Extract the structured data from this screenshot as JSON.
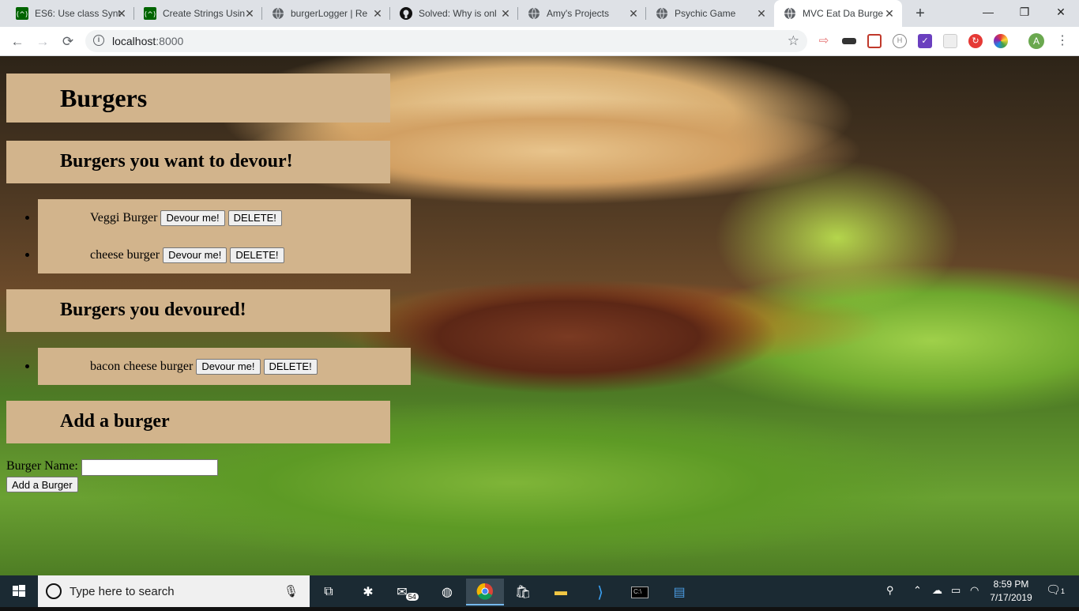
{
  "browser": {
    "tabs": [
      {
        "title": "ES6: Use class Synt",
        "icon": "freecodecamp-icon",
        "active": false
      },
      {
        "title": "Create Strings Usin",
        "icon": "freecodecamp-icon",
        "active": false
      },
      {
        "title": "burgerLogger | Re",
        "icon": "globe-icon",
        "active": false
      },
      {
        "title": "Solved: Why is onl",
        "icon": "github-icon",
        "active": false
      },
      {
        "title": "Amy's Projects",
        "icon": "globe-icon",
        "active": false
      },
      {
        "title": "Psychic Game",
        "icon": "globe-icon",
        "active": false
      },
      {
        "title": "MVC Eat Da Burge",
        "icon": "globe-icon",
        "active": true
      }
    ],
    "new_tab_label": "+",
    "window_controls": {
      "minimize": "—",
      "maximize": "❐",
      "close": "✕"
    },
    "nav": {
      "back": "←",
      "forward": "→",
      "reload": "⟳"
    },
    "url": {
      "host": "localhost",
      "port": ":8000"
    },
    "profile_initial": "A"
  },
  "page": {
    "title": "Burgers",
    "sections": {
      "want_heading": "Burgers you want to devour!",
      "devoured_heading": "Burgers you devoured!",
      "add_heading": "Add a burger"
    },
    "to_devour": [
      {
        "name": "Veggi Burger",
        "devour_label": "Devour me!",
        "delete_label": "DELETE!"
      },
      {
        "name": "cheese burger",
        "devour_label": "Devour me!",
        "delete_label": "DELETE!"
      }
    ],
    "devoured": [
      {
        "name": "bacon cheese burger",
        "devour_label": "Devour me!",
        "delete_label": "DELETE!"
      }
    ],
    "form": {
      "label": "Burger Name:",
      "value": "",
      "submit_label": "Add a Burger"
    },
    "heading_bg": "#d2b48c"
  },
  "taskbar": {
    "search_placeholder": "Type here to search",
    "mail_badge": "54",
    "time": "8:59 PM",
    "date": "7/17/2019",
    "notification_count": "1"
  }
}
